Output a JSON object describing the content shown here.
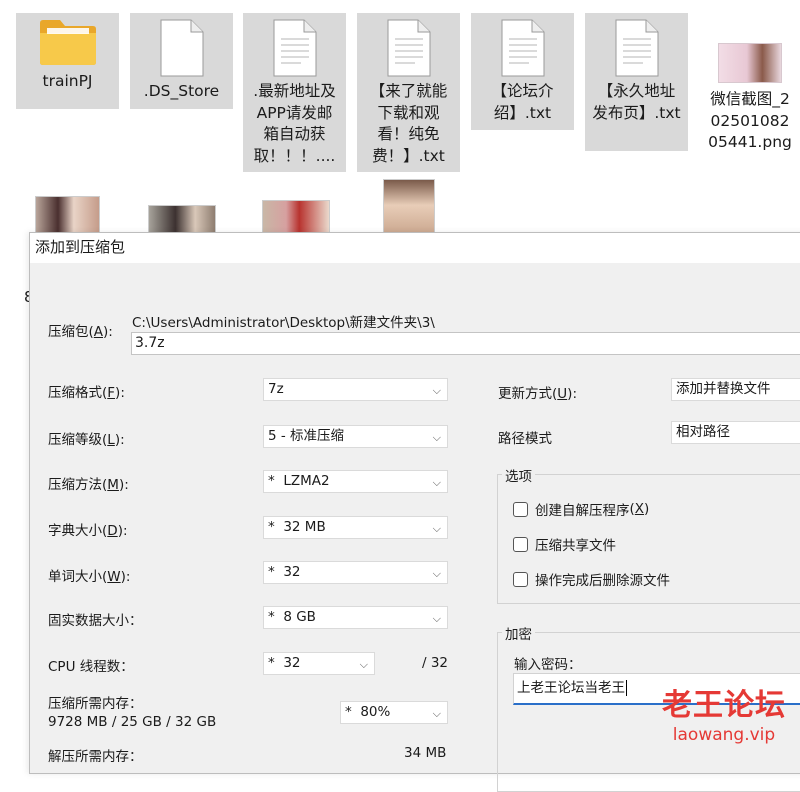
{
  "desktop": {
    "files": [
      {
        "label": "trainPJ",
        "icon": "folder-icon"
      },
      {
        "label": ".DS_Store",
        "icon": "file-icon"
      },
      {
        "label": ".最新地址及APP请发邮箱自动获取！！！....",
        "icon": "text-file-icon"
      },
      {
        "label": "【来了就能下载和观看！纯免费！】.txt",
        "icon": "text-file-icon"
      },
      {
        "label": "【论坛介绍】.txt",
        "icon": "text-file-icon"
      },
      {
        "label": "【永久地址发布页】.txt",
        "icon": "text-file-icon"
      },
      {
        "label": "微信截图_20250108205441.png",
        "icon": "image-thumbnail-icon"
      }
    ],
    "partial_label": "8"
  },
  "dialog": {
    "title": "添加到压缩包",
    "archive": {
      "label": "压缩包",
      "accel": "A",
      "path": "C:\\Users\\Administrator\\Desktop\\新建文件夹\\3\\",
      "value": "3.7z"
    },
    "left": {
      "format": {
        "label": "压缩格式",
        "accel": "F",
        "value": "7z"
      },
      "level": {
        "label": "压缩等级",
        "accel": "L",
        "value": "5 - 标准压缩"
      },
      "method": {
        "label": "压缩方法",
        "accel": "M",
        "value": "*  LZMA2"
      },
      "dict": {
        "label": "字典大小",
        "accel": "D",
        "value": "*  32 MB"
      },
      "word": {
        "label": "单词大小",
        "accel": "W",
        "value": "*  32"
      },
      "solid": {
        "label": "固实数据大小：",
        "value": "*  8 GB"
      },
      "threads": {
        "label": "CPU 线程数：",
        "value": "*  32",
        "total": "/ 32"
      },
      "mem_comp": {
        "label": "压缩所需内存：",
        "detail": "9728 MB / 25 GB / 32 GB",
        "value": "*  80%"
      },
      "mem_decomp": {
        "label": "解压所需内存：",
        "value": "34 MB"
      }
    },
    "right": {
      "update": {
        "label": "更新方式",
        "accel": "U",
        "value": "添加并替换文件"
      },
      "pathmode": {
        "label": "路径模式",
        "value": "相对路径"
      },
      "options": {
        "title": "选项",
        "items": [
          {
            "label": "创建自解压程序",
            "accel": "X"
          },
          {
            "label": "压缩共享文件"
          },
          {
            "label": "操作完成后删除源文件"
          }
        ]
      },
      "encrypt": {
        "title": "加密",
        "pwd_label": "输入密码：",
        "pwd_value": "上老王论坛当老王"
      }
    }
  },
  "watermark": {
    "cn": "老王论坛",
    "en": "laowang.vip",
    "color": "#e53935"
  }
}
